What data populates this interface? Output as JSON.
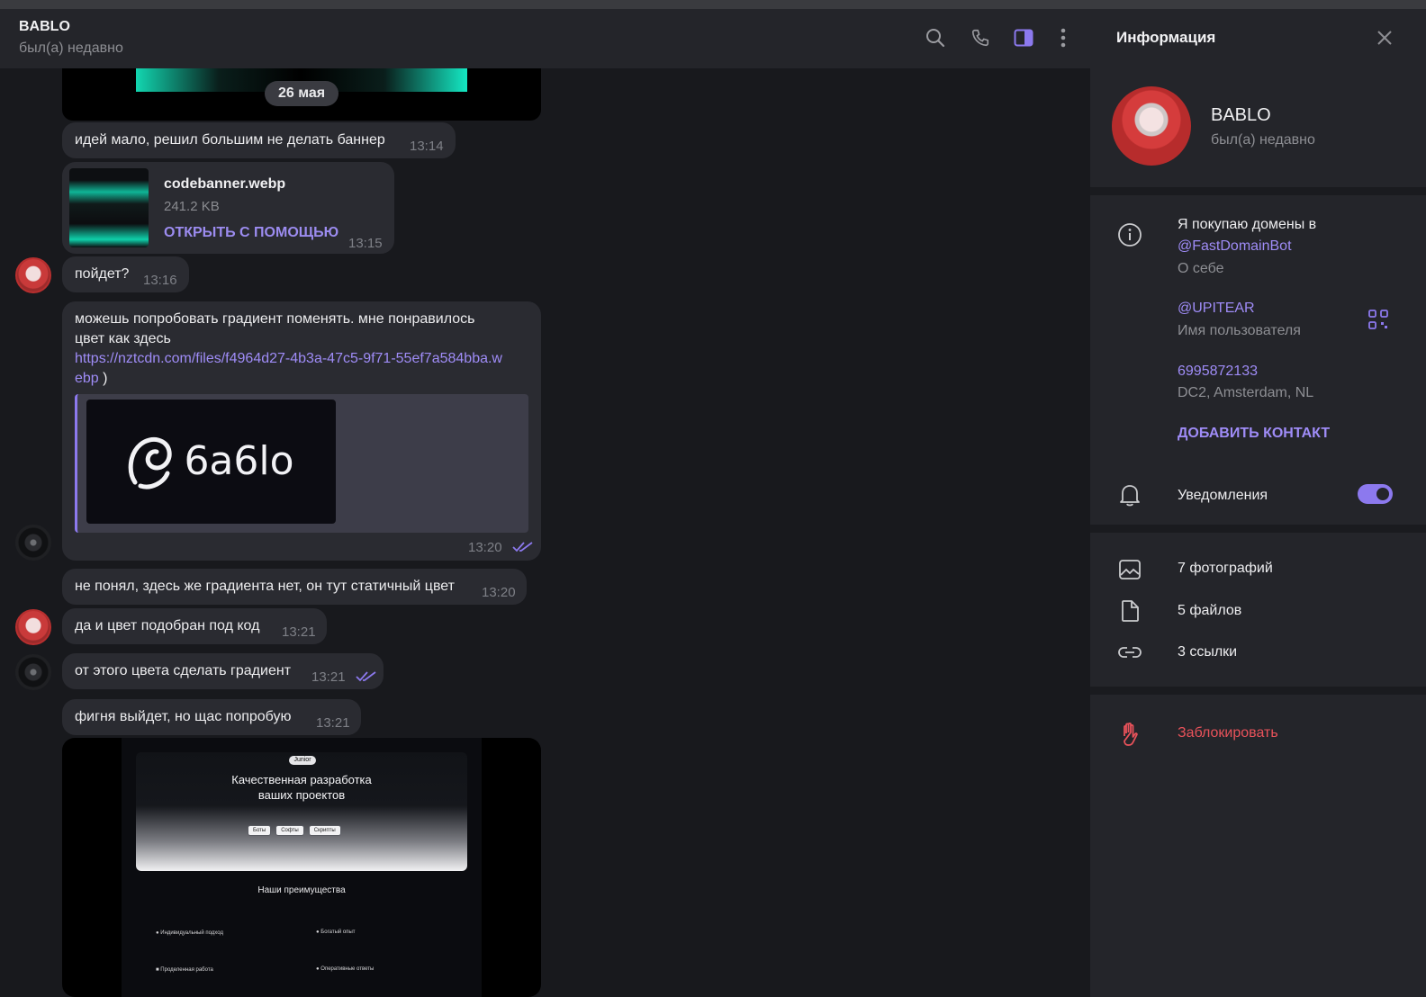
{
  "header": {
    "title": "BABLO",
    "status": "был(а) недавно"
  },
  "messages": {
    "date": "26 мая",
    "m1": {
      "text": "идей мало, решил большим не делать баннер",
      "time": "13:14"
    },
    "file": {
      "name": "codebanner.webp",
      "size": "241.2 KB",
      "action": "ОТКРЫТЬ С ПОМОЩЬЮ",
      "time": "13:15"
    },
    "m2": {
      "text": "пойдет?",
      "time": "13:16"
    },
    "m3": {
      "line1": "можешь попробовать градиент поменять. мне понравилось",
      "line2": "цвет как здесь",
      "link1": "https://nztcdn.com/files/f4964d27-4b3a-47c5-9f71-55ef7a584bba.w",
      "link2": "ebp",
      "after": " )",
      "preview_brand": "6a6lo",
      "time": "13:20"
    },
    "m4": {
      "text": "не понял, здесь же градиента нет, он тут статичный цвет",
      "time": "13:20"
    },
    "m5": {
      "text": "да и цвет подобран под код",
      "time": "13:21"
    },
    "m6": {
      "text": "от этого цвета сделать градиент",
      "time": "13:21"
    },
    "m7": {
      "text": "фигня выйдет, но щас попробую",
      "time": "13:21"
    },
    "banner": {
      "pill": "Junior",
      "heading_line1": "Качественная разработка",
      "heading_line2": "ваших проектов",
      "buttons": [
        "Боты",
        "Софты",
        "Скрипты"
      ],
      "section": "Наши преимущества",
      "items": [
        "Индивидуальный подход",
        "Богатый опыт",
        "Проделенная работа",
        "Оперативные ответы"
      ]
    }
  },
  "sidebar": {
    "title": "Информация",
    "name": "BABLO",
    "status": "был(а) недавно",
    "bio_line1": "Я покупаю домены в",
    "bio_link": "@FastDomainBot",
    "bio_label": "О себе",
    "username": "@UPITEAR",
    "username_label": "Имя пользователя",
    "user_id": "6995872133",
    "dc": "DC2, Amsterdam, NL",
    "add_contact": "ДОБАВИТЬ КОНТАКТ",
    "notifications": "Уведомления",
    "notifications_on": true,
    "photos": "7 фотографий",
    "files": "5 файлов",
    "links": "3 ссылки",
    "block": "Заблокировать"
  },
  "colors": {
    "accent": "#8c79ee",
    "link": "#9f8cf7",
    "danger": "#e8525a"
  }
}
